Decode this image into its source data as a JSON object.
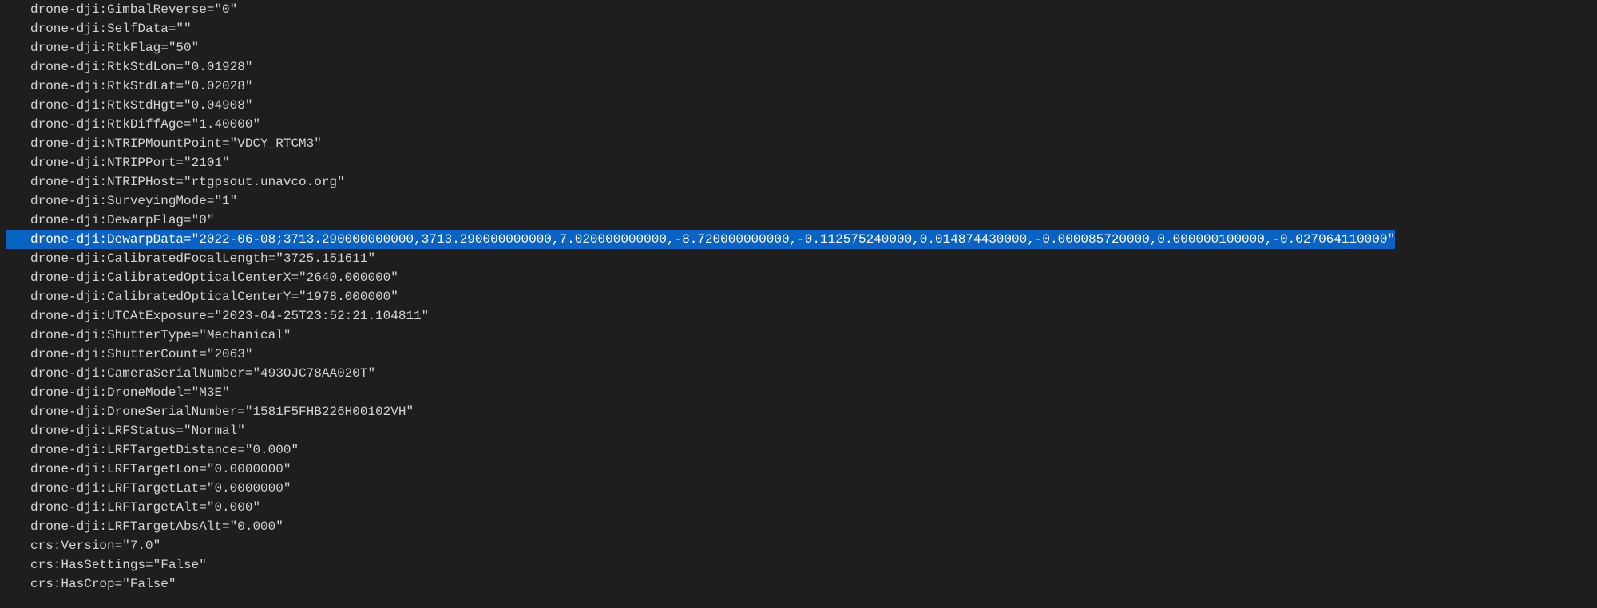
{
  "lines": [
    {
      "text": "drone-dji:GimbalReverse=\"0\"",
      "selected": false
    },
    {
      "text": "drone-dji:SelfData=\"\"",
      "selected": false
    },
    {
      "text": "drone-dji:RtkFlag=\"50\"",
      "selected": false
    },
    {
      "text": "drone-dji:RtkStdLon=\"0.01928\"",
      "selected": false
    },
    {
      "text": "drone-dji:RtkStdLat=\"0.02028\"",
      "selected": false
    },
    {
      "text": "drone-dji:RtkStdHgt=\"0.04908\"",
      "selected": false
    },
    {
      "text": "drone-dji:RtkDiffAge=\"1.40000\"",
      "selected": false
    },
    {
      "text": "drone-dji:NTRIPMountPoint=\"VDCY_RTCM3\"",
      "selected": false
    },
    {
      "text": "drone-dji:NTRIPPort=\"2101\"",
      "selected": false
    },
    {
      "text": "drone-dji:NTRIPHost=\"rtgpsout.unavco.org\"",
      "selected": false
    },
    {
      "text": "drone-dji:SurveyingMode=\"1\"",
      "selected": false
    },
    {
      "text": "drone-dji:DewarpFlag=\"0\"",
      "selected": false
    },
    {
      "text": "drone-dji:DewarpData=\"2022-06-08;3713.290000000000,3713.290000000000,7.020000000000,-8.720000000000,-0.112575240000,0.014874430000,-0.000085720000,0.000000100000,-0.027064110000\"",
      "selected": true
    },
    {
      "text": "drone-dji:CalibratedFocalLength=\"3725.151611\"",
      "selected": false
    },
    {
      "text": "drone-dji:CalibratedOpticalCenterX=\"2640.000000\"",
      "selected": false
    },
    {
      "text": "drone-dji:CalibratedOpticalCenterY=\"1978.000000\"",
      "selected": false
    },
    {
      "text": "drone-dji:UTCAtExposure=\"2023-04-25T23:52:21.104811\"",
      "selected": false
    },
    {
      "text": "drone-dji:ShutterType=\"Mechanical\"",
      "selected": false
    },
    {
      "text": "drone-dji:ShutterCount=\"2063\"",
      "selected": false
    },
    {
      "text": "drone-dji:CameraSerialNumber=\"493OJC78AA020T\"",
      "selected": false
    },
    {
      "text": "drone-dji:DroneModel=\"M3E\"",
      "selected": false
    },
    {
      "text": "drone-dji:DroneSerialNumber=\"1581F5FHB226H00102VH\"",
      "selected": false
    },
    {
      "text": "drone-dji:LRFStatus=\"Normal\"",
      "selected": false
    },
    {
      "text": "drone-dji:LRFTargetDistance=\"0.000\"",
      "selected": false
    },
    {
      "text": "drone-dji:LRFTargetLon=\"0.0000000\"",
      "selected": false
    },
    {
      "text": "drone-dji:LRFTargetLat=\"0.0000000\"",
      "selected": false
    },
    {
      "text": "drone-dji:LRFTargetAlt=\"0.000\"",
      "selected": false
    },
    {
      "text": "drone-dji:LRFTargetAbsAlt=\"0.000\"",
      "selected": false
    },
    {
      "text": "crs:Version=\"7.0\"",
      "selected": false
    },
    {
      "text": "crs:HasSettings=\"False\"",
      "selected": false
    },
    {
      "text": "crs:HasCrop=\"False\"",
      "selected": false
    }
  ]
}
